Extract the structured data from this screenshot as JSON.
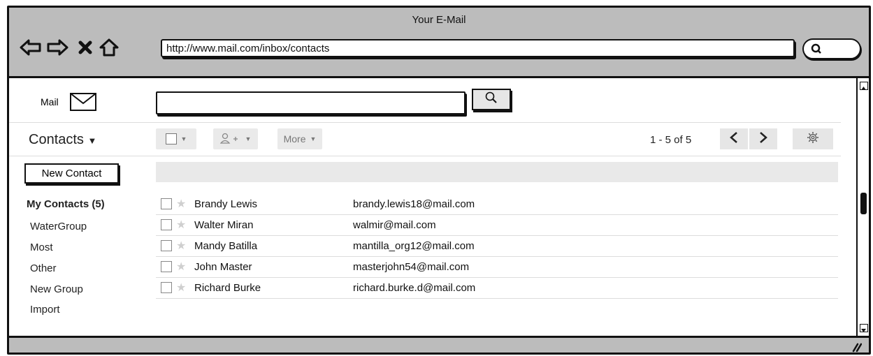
{
  "window": {
    "title": "Your E-Mail"
  },
  "browser": {
    "url": "http://www.mail.com/inbox/contacts",
    "icons": [
      "back-arrow-icon",
      "forward-arrow-icon",
      "close-x-icon",
      "home-icon",
      "search-icon"
    ]
  },
  "header": {
    "mail_label": "Mail",
    "search_placeholder": ""
  },
  "toolbar": {
    "title": "Contacts",
    "more_label": "More",
    "pager_text": "1 - 5 of 5"
  },
  "sidebar": {
    "new_contact_label": "New Contact",
    "items": [
      {
        "label": "My Contacts (5)"
      },
      {
        "label": "WaterGroup"
      },
      {
        "label": "Most"
      },
      {
        "label": "Other"
      },
      {
        "label": "New Group"
      },
      {
        "label": "Import"
      }
    ]
  },
  "contacts": [
    {
      "name": "Brandy Lewis",
      "email": "brandy.lewis18@mail.com"
    },
    {
      "name": "Walter Miran",
      "email": "walmir@mail.com"
    },
    {
      "name": "Mandy Batilla",
      "email": "mantilla_org12@mail.com"
    },
    {
      "name": "John Master",
      "email": "masterjohn54@mail.com"
    },
    {
      "name": "Richard Burke",
      "email": "richard.burke.d@mail.com"
    }
  ],
  "colors": {
    "chrome": "#bcbcbc",
    "border": "#111111",
    "toolbar_button": "#eaeaea",
    "star": "#cfcfcf"
  }
}
